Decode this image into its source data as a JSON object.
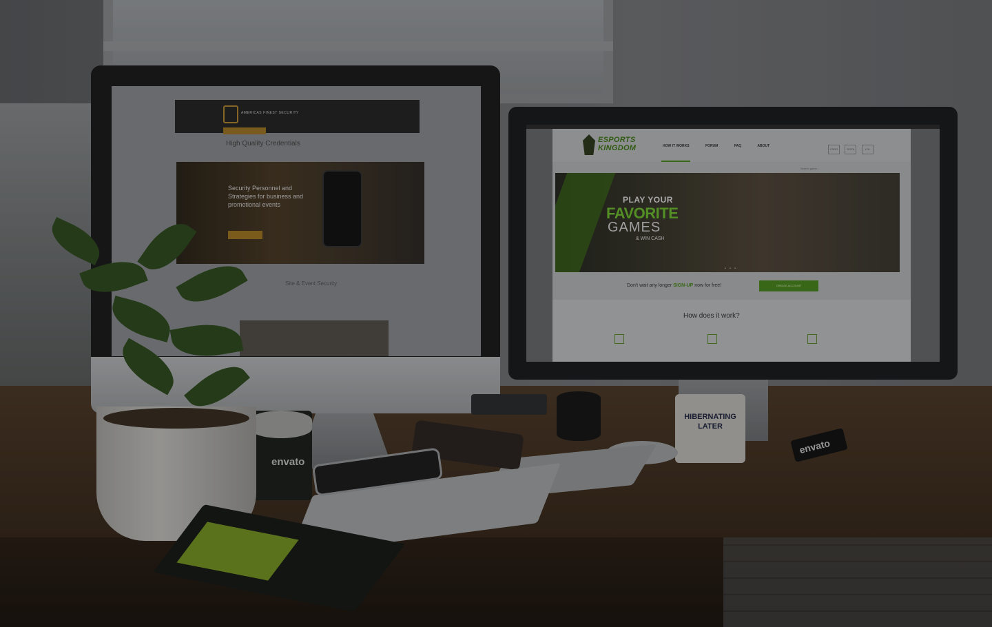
{
  "imac_site": {
    "brand": "AMERICAS FINEST SECURITY",
    "title": "High Quality Credentials",
    "hero_heading": "Security Personnel and Strategies for business and promotional events",
    "subtitle": "Site & Event Security"
  },
  "esports_site": {
    "logo_line1": "ESPORTS",
    "logo_line2": "KINGDOM",
    "nav": [
      "HOW IT WORKS",
      "FORUM",
      "FAQ",
      "ABOUT"
    ],
    "header_icons": [
      "CSGO",
      "DOTA",
      "LOL"
    ],
    "search_placeholder": "Search game...",
    "hero_line1": "PLAY YOUR",
    "hero_line2": "FAVORITE",
    "hero_line3": "GAMES",
    "hero_line4": "& WIN CASH",
    "cta_pre": "Don't wait any longer",
    "cta_highlight": "SIGN-UP",
    "cta_post": "now for free!",
    "cta_button": "CREATE ACCOUNT",
    "how_title": "How does it work?"
  },
  "desk": {
    "cup_label": "envato",
    "mug_line1": "HIBERNATING",
    "mug_line2": "LATER",
    "lanyard_label": "envato"
  },
  "colors": {
    "esports_green": "#4a8c1c",
    "security_gold": "#a47a24"
  }
}
